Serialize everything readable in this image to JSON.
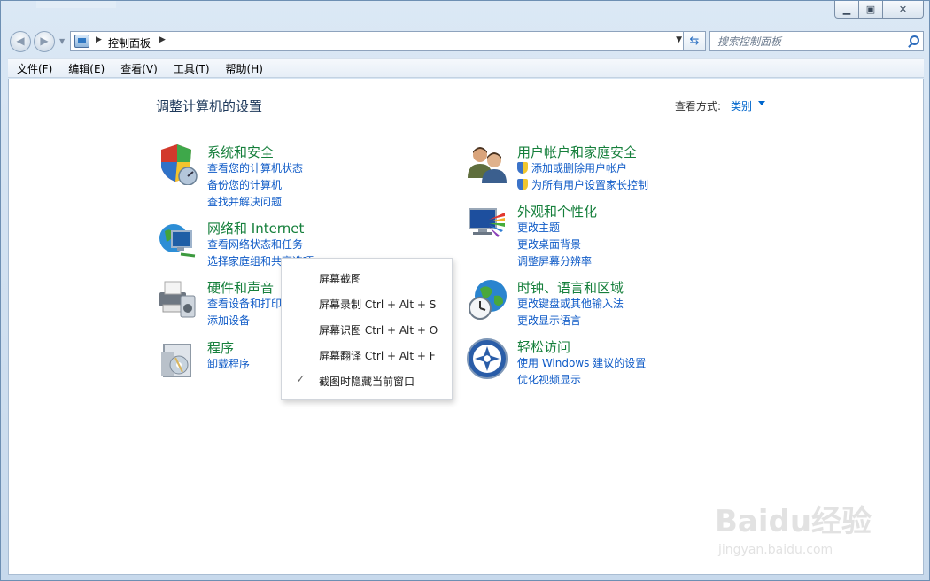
{
  "nav": {
    "breadcrumb": "控制面板",
    "search_placeholder": "搜索控制面板"
  },
  "menu": [
    "文件(F)",
    "编辑(E)",
    "查看(V)",
    "工具(T)",
    "帮助(H)"
  ],
  "main": {
    "title": "调整计算机的设置",
    "view_label": "查看方式:",
    "view_value": "类别"
  },
  "categories": [
    {
      "title": "系统和安全",
      "links": [
        "查看您的计算机状态",
        "备份您的计算机",
        "查找并解决问题"
      ]
    },
    {
      "title": "网络和 Internet",
      "links": [
        "查看网络状态和任务",
        "选择家庭组和共享选项"
      ]
    },
    {
      "title": "硬件和声音",
      "links": [
        "查看设备和打印机",
        "添加设备"
      ]
    },
    {
      "title": "程序",
      "links": [
        "卸载程序"
      ]
    },
    {
      "title": "用户帐户和家庭安全",
      "links": [
        "添加或删除用户帐户",
        "为所有用户设置家长控制"
      ]
    },
    {
      "title": "外观和个性化",
      "links": [
        "更改主题",
        "更改桌面背景",
        "调整屏幕分辨率"
      ]
    },
    {
      "title": "时钟、语言和区域",
      "links": [
        "更改键盘或其他输入法",
        "更改显示语言"
      ]
    },
    {
      "title": "轻松访问",
      "links": [
        "使用 Windows 建议的设置",
        "优化视频显示"
      ]
    }
  ],
  "context_menu": {
    "items": [
      "屏幕截图",
      "屏幕录制 Ctrl + Alt + S",
      "屏幕识图 Ctrl + Alt + O",
      "屏幕翻译 Ctrl + Alt + F",
      "截图时隐藏当前窗口"
    ],
    "checked_item": "截图时隐藏当前窗口"
  },
  "watermark": {
    "logo": "Baidu经验",
    "url": "jingyan.baidu.com"
  },
  "icons": {
    "system_security": "shield-icon",
    "network": "globe-network-icon",
    "hardware": "printer-icon",
    "programs": "programs-icon",
    "user_accounts": "users-icon",
    "appearance": "monitor-palette-icon",
    "clock": "clock-globe-icon",
    "ease_of_access": "ease-of-access-icon"
  }
}
